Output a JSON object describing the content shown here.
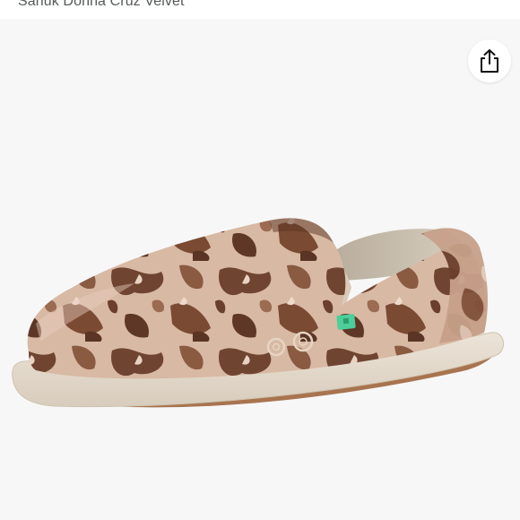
{
  "product": {
    "title": "Sanuk Donna Cruz Velvet"
  },
  "actions": {
    "share_icon": "share-icon"
  },
  "colors": {
    "panel_background": "#f7f7f7",
    "velvet_dark": "#6b3f2c",
    "velvet_light": "#d9b9a4",
    "sole": "#e3d8c9",
    "outsole": "#a0714d",
    "tag_green": "#4ccf9a"
  }
}
